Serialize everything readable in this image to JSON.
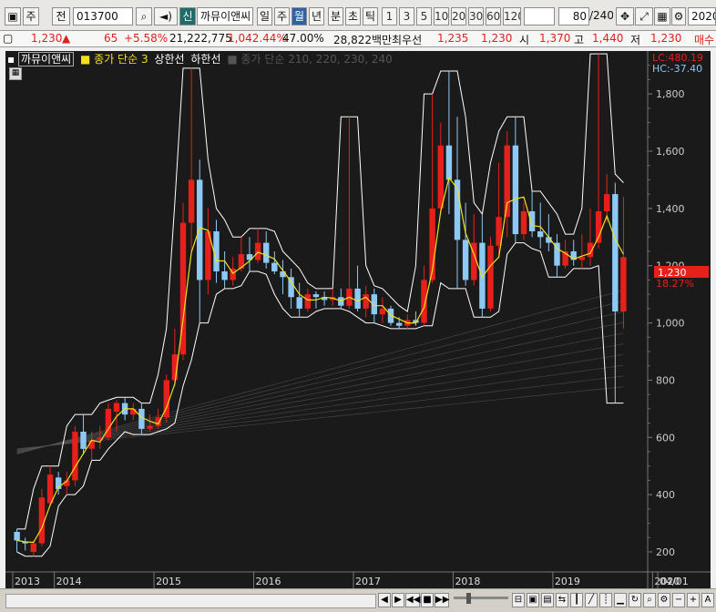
{
  "toolbar": {
    "market": "주",
    "type": "전",
    "code": "013700",
    "shin": "신",
    "stock_name": "까뮤이앤씨",
    "periods": [
      "일",
      "주",
      "월",
      "년",
      "분",
      "초",
      "틱"
    ],
    "active_period": "월",
    "numbers": [
      "1",
      "3",
      "5",
      "10",
      "20",
      "30",
      "60",
      "120"
    ],
    "count": "80",
    "total": "/240",
    "date": "2020/"
  },
  "info": {
    "price": "1,230",
    "change_arrow": "▲",
    "change": "65",
    "change_pct": "+5.58%",
    "volume": "21,222,775",
    "vol_ratio": "1,042.44%",
    "turnover": "47.00%",
    "amount": "28,822백만",
    "best_ask_label": "최우선",
    "ask": "1,235",
    "bid": "1,230",
    "open_label": "시",
    "open": "1,370",
    "high_label": "고",
    "high": "1,440",
    "low_label": "저",
    "low": "1,230",
    "more": "매수"
  },
  "legend": {
    "name": "까뮤이앤씨",
    "ma": "종가 단순 3",
    "upper": "상한선",
    "lower": "하한선",
    "ma_set": "종가 단순 210, 220, 230, 240"
  },
  "right_info": {
    "lc": "LC:480.19",
    "hc": "HC:-37.40",
    "price_tag": "1,230",
    "pct_tag": "18.27%"
  },
  "colors": {
    "up": "#e8201c",
    "down": "#8ec8f5",
    "ma": "#f0e020",
    "band": "#ffffff",
    "bg": "#1a1a1a"
  },
  "chart_data": {
    "type": "candlestick",
    "y_ticks": [
      200,
      400,
      600,
      800,
      "1,000",
      "1,200",
      "1,400",
      "1,600",
      "1,800"
    ],
    "x_labels": [
      "2013",
      "2014",
      "2015",
      "2016",
      "2017",
      "2018",
      "2019",
      "2020",
      "04/01"
    ],
    "ylim": [
      130,
      1950
    ],
    "candles": [
      [
        270,
        240,
        200,
        280
      ],
      [
        235,
        230,
        205,
        250
      ],
      [
        200,
        230,
        185,
        240
      ],
      [
        230,
        390,
        220,
        420
      ],
      [
        370,
        470,
        360,
        500
      ],
      [
        460,
        420,
        400,
        480
      ],
      [
        430,
        450,
        400,
        480
      ],
      [
        450,
        620,
        430,
        640
      ],
      [
        620,
        560,
        540,
        680
      ],
      [
        560,
        590,
        520,
        620
      ],
      [
        590,
        600,
        560,
        640
      ],
      [
        600,
        700,
        590,
        720
      ],
      [
        690,
        720,
        620,
        730
      ],
      [
        720,
        680,
        660,
        740
      ],
      [
        680,
        700,
        660,
        720
      ],
      [
        700,
        630,
        610,
        720
      ],
      [
        630,
        640,
        620,
        680
      ],
      [
        640,
        670,
        630,
        700
      ],
      [
        670,
        800,
        650,
        820
      ],
      [
        800,
        890,
        780,
        980
      ],
      [
        890,
        1350,
        870,
        1420
      ],
      [
        1350,
        1500,
        1250,
        1890
      ],
      [
        1500,
        1150,
        1000,
        1570
      ],
      [
        1150,
        1320,
        1100,
        1400
      ],
      [
        1320,
        1180,
        1140,
        1360
      ],
      [
        1180,
        1150,
        1120,
        1250
      ],
      [
        1150,
        1190,
        1130,
        1230
      ],
      [
        1190,
        1240,
        1180,
        1300
      ],
      [
        1240,
        1220,
        1180,
        1300
      ],
      [
        1220,
        1280,
        1210,
        1330
      ],
      [
        1280,
        1210,
        1190,
        1320
      ],
      [
        1210,
        1180,
        1170,
        1250
      ],
      [
        1180,
        1160,
        1100,
        1220
      ],
      [
        1160,
        1090,
        1050,
        1190
      ],
      [
        1090,
        1050,
        1020,
        1140
      ],
      [
        1050,
        1100,
        1040,
        1120
      ],
      [
        1100,
        1090,
        1050,
        1110
      ],
      [
        1090,
        1080,
        1060,
        1110
      ],
      [
        1080,
        1090,
        1060,
        1120
      ],
      [
        1090,
        1060,
        1050,
        1120
      ],
      [
        1060,
        1120,
        1050,
        1720
      ],
      [
        1120,
        1050,
        1040,
        1200
      ],
      [
        1050,
        1100,
        1020,
        1130
      ],
      [
        1100,
        1030,
        1000,
        1120
      ],
      [
        1030,
        1050,
        1000,
        1090
      ],
      [
        1050,
        1000,
        990,
        1060
      ],
      [
        1000,
        990,
        980,
        1020
      ],
      [
        990,
        1010,
        980,
        1030
      ],
      [
        1010,
        1000,
        990,
        1040
      ],
      [
        1000,
        1150,
        990,
        1200
      ],
      [
        1150,
        1400,
        1140,
        1800
      ],
      [
        1400,
        1620,
        1380,
        1700
      ],
      [
        1620,
        1500,
        1380,
        1880
      ],
      [
        1500,
        1290,
        1120,
        1720
      ],
      [
        1290,
        1150,
        1130,
        1420
      ],
      [
        1150,
        1280,
        1130,
        1380
      ],
      [
        1280,
        1050,
        1020,
        1380
      ],
      [
        1050,
        1270,
        1040,
        1300
      ],
      [
        1270,
        1370,
        1240,
        1560
      ],
      [
        1370,
        1620,
        1300,
        1670
      ],
      [
        1620,
        1310,
        1280,
        1720
      ],
      [
        1310,
        1390,
        1290,
        1420
      ],
      [
        1390,
        1320,
        1300,
        1460
      ],
      [
        1320,
        1300,
        1260,
        1420
      ],
      [
        1300,
        1280,
        1250,
        1380
      ],
      [
        1280,
        1200,
        1160,
        1310
      ],
      [
        1200,
        1250,
        1190,
        1290
      ],
      [
        1250,
        1220,
        1200,
        1290
      ],
      [
        1220,
        1230,
        1190,
        1310
      ],
      [
        1230,
        1280,
        1200,
        1400
      ],
      [
        1280,
        1390,
        1260,
        1940
      ],
      [
        1390,
        1450,
        1350,
        1520
      ],
      [
        1450,
        1040,
        720,
        1490
      ],
      [
        1040,
        1230,
        980,
        1440
      ]
    ],
    "ma_lines": 10
  },
  "status": {
    "buttons": [
      "◀",
      "▶",
      "◀◀",
      "■",
      "▶▶"
    ]
  }
}
